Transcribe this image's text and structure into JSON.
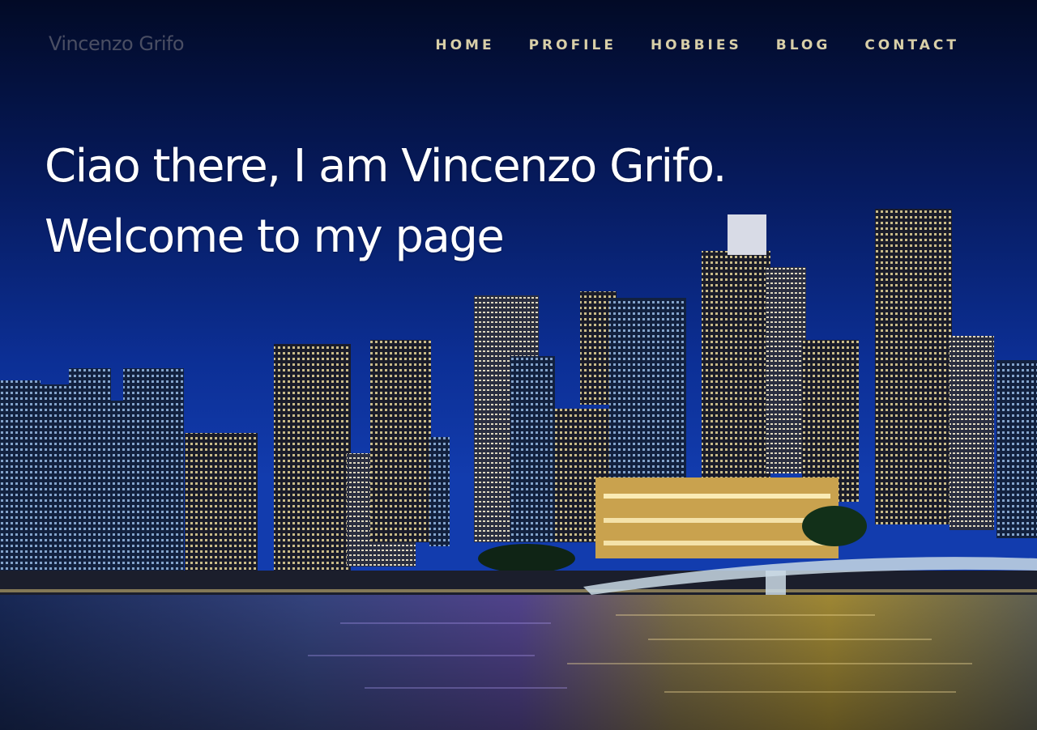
{
  "header": {
    "brand": "Vincenzo Grifo",
    "nav": [
      {
        "label": "HOME"
      },
      {
        "label": "PROFILE"
      },
      {
        "label": "HOBBIES"
      },
      {
        "label": "BLOG"
      },
      {
        "label": "CONTACT"
      }
    ]
  },
  "hero": {
    "line1": "Ciao there, I am Vincenzo Grifo.",
    "line2": "Welcome to my page"
  },
  "colors": {
    "sky_top": "#020a2a",
    "sky_bottom": "#0b2a8a",
    "nav_text": "#d8cfa8",
    "brand_text": "#4a4e63",
    "hero_text": "#ffffff"
  },
  "background": {
    "image": "night city skyline with waterfront reflections"
  }
}
